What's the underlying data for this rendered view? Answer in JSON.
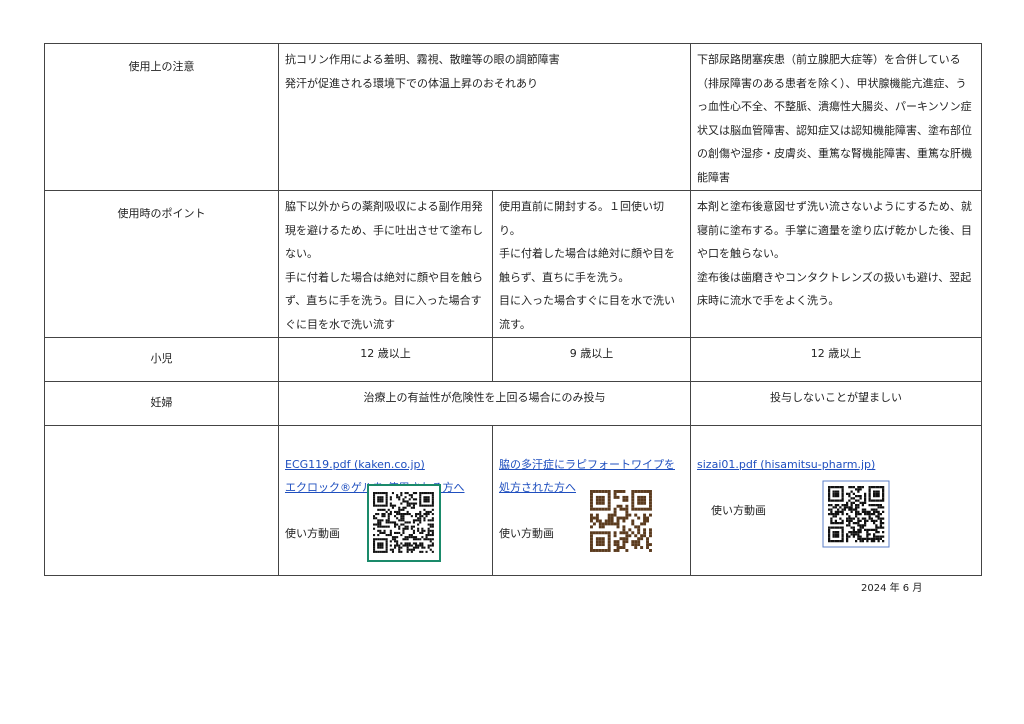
{
  "rows": {
    "caution": {
      "label": "使用上の注意",
      "col_ab": "抗コリン作用による羞明、霧視、散瞳等の眼の調節障害\n発汗が促進される環境下での体温上昇のおそれあり",
      "col_c": "下部尿路閉塞疾患（前立腺肥大症等）を合併している（排尿障害のある患者を除く）、甲状腺機能亢進症、うっ血性心不全、不整脈、潰瘍性大腸炎、パーキンソン症状又は脳血管障害、認知症又は認知機能障害、塗布部位の創傷や湿疹・皮膚炎、重篤な腎機能障害、重篤な肝機能障害"
    },
    "points": {
      "label": "使用時のポイント",
      "col_a": "脇下以外からの薬剤吸収による副作用発現を避けるため、手に吐出させて塗布しない。\n手に付着した場合は絶対に顔や目を触らず、直ちに手を洗う。目に入った場合すぐに目を水で洗い流す",
      "col_b": "使用直前に開封する。１回使い切り。\n手に付着した場合は絶対に顔や目を触らず、直ちに手を洗う。\n目に入った場合すぐに目を水で洗い流す。",
      "col_c": "本剤と塗布後意図せず洗い流さないようにするため、就寝前に塗布する。手掌に適量を塗り広げ乾かした後、目や口を触らない。\n塗布後は歯磨きやコンタクトレンズの扱いも避け、翌起床時に流水で手をよく洗う。"
    },
    "child": {
      "label": "小児",
      "col_a": "12 歳以上",
      "col_b": "9 歳以上",
      "col_c": "12 歳以上"
    },
    "pregnant": {
      "label": "妊婦",
      "col_ab": "治療上の有益性が危険性を上回る場合にのみ投与",
      "col_c": "投与しないことが望ましい"
    },
    "links": {
      "label": "",
      "col_a_link1": "ECG119.pdf (kaken.co.jp)",
      "col_a_link2": "エクロック®ゲルを 使用される方へ",
      "col_a_video": "使い方動画",
      "col_b_link": "脇の多汗症にラピフォートワイプを処方された方へ",
      "col_b_video": "使い方動画",
      "col_c_link": "sizai01.pdf (hisamitsu-pharm.jp)",
      "col_c_video": "使い方動画"
    }
  },
  "date": "2024 年 6 月",
  "colors": {
    "link": "#1f4fbf",
    "qr_border_green": "#1a8a6a",
    "qr_brown": "#5b3b1e",
    "qr_border_blue": "#5b7fc9"
  }
}
